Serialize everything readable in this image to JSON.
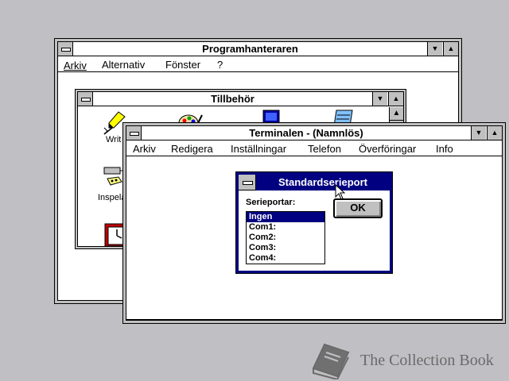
{
  "program_manager": {
    "title": "Programhanteraren",
    "menu": [
      "Arkiv",
      "Alternativ",
      "Fönster",
      "?"
    ]
  },
  "accessories": {
    "title": "Tillbehör",
    "icons": [
      {
        "label": "Writ",
        "icon": "pen-icon"
      },
      {
        "label": "Inspela",
        "icon": "recorder-icon"
      },
      {
        "label": "",
        "icon": "paintbrush-icon"
      },
      {
        "label": "",
        "icon": "terminal-icon"
      },
      {
        "label": "",
        "icon": "notepad-icon"
      },
      {
        "label": "",
        "icon": "clock-icon"
      }
    ]
  },
  "terminal": {
    "title": "Terminalen - (Namnlös)",
    "menu": [
      "Arkiv",
      "Redigera",
      "Inställningar",
      "Telefon",
      "Överföringar",
      "Info"
    ]
  },
  "dialog": {
    "title": "Standardserieport",
    "list_label": "Serieportar:",
    "ports": [
      "Ingen",
      "Com1:",
      "Com2:",
      "Com3:",
      "Com4:"
    ],
    "selected": "Ingen",
    "ok_label": "OK"
  },
  "watermark": {
    "text": "The Collection Book"
  },
  "colors": {
    "desktop": "#c0c0c4",
    "active_title": "#000080",
    "face": "#c0c0c0"
  }
}
